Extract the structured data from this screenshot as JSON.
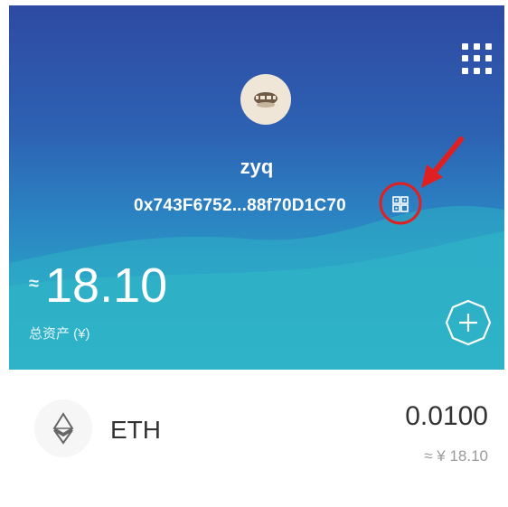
{
  "header": {
    "username": "zyq",
    "address": "0x743F6752...88f70D1C70",
    "approx_symbol": "≈",
    "total_value": "18.10",
    "total_label": "总资产 (¥)",
    "colors": {
      "gradient_top": "#2e4aa3",
      "gradient_bottom": "#2aa9c7",
      "annotation_red": "#e02020"
    },
    "icons": {
      "menu": "grid-menu-icon",
      "avatar": "avatar-icon",
      "qr": "qr-code-icon",
      "add": "add-icon"
    }
  },
  "assets": [
    {
      "symbol": "ETH",
      "icon": "ethereum-icon",
      "amount": "0.0100",
      "fiat_value": "≈ ¥ 18.10"
    }
  ]
}
